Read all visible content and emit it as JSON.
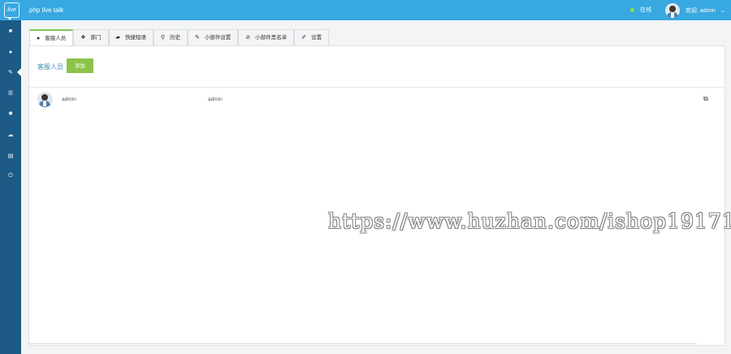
{
  "header": {
    "logo_text": "live",
    "app_title": "php live talk",
    "status_text": "在线",
    "user_greeting": "欢迎, admin",
    "chevron": "⌄",
    "colors": {
      "bar": "#38a8e0",
      "status_dot": "#8be04e"
    }
  },
  "sidebar": {
    "items": [
      {
        "icon": "chat-icon",
        "glyph": "■"
      },
      {
        "icon": "location-icon",
        "glyph": "●"
      },
      {
        "icon": "wrench-icon",
        "glyph": "✎"
      },
      {
        "icon": "list-icon",
        "glyph": "☰"
      },
      {
        "icon": "gear-icon",
        "glyph": "✹"
      },
      {
        "icon": "cloud-icon",
        "glyph": "☁"
      },
      {
        "icon": "chart-icon",
        "glyph": "▤"
      },
      {
        "icon": "power-icon",
        "glyph": "⏻"
      }
    ]
  },
  "tabs": [
    {
      "label": "客服人员",
      "icon": "user-icon",
      "glyph": "👤"
    },
    {
      "label": "部门",
      "icon": "group-icon",
      "glyph": "⚇"
    },
    {
      "label": "快捷短语",
      "icon": "comments-icon",
      "glyph": "✉"
    },
    {
      "label": "历史",
      "icon": "search-icon",
      "glyph": "⌕"
    },
    {
      "label": "小部件设置",
      "icon": "brush-icon",
      "glyph": "✐"
    },
    {
      "label": "小部件黑名单",
      "icon": "ban-icon",
      "glyph": "⊘"
    },
    {
      "label": "设置",
      "icon": "wrench-icon",
      "glyph": "✎"
    }
  ],
  "section": {
    "title": "客服人员",
    "add_label": "添加"
  },
  "agents": [
    {
      "name": "admin",
      "role": "admin",
      "edit_icon": "edit-icon",
      "edit_glyph": "⧉"
    }
  ],
  "watermark": "https://www.huzhan.com/ishop19171"
}
